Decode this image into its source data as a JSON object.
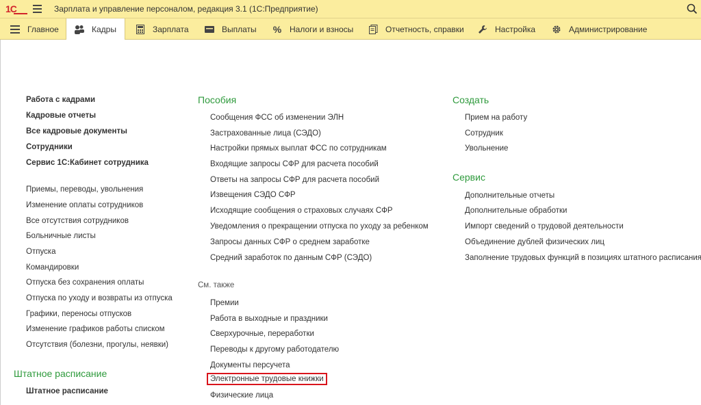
{
  "app": {
    "logo_text": "1С",
    "title": "Зарплата и управление персоналом, редакция 3.1  (1С:Предприятие)"
  },
  "sections": [
    {
      "label": "Главное",
      "icon": "menu-lines-icon"
    },
    {
      "label": "Кадры",
      "icon": "users-icon"
    },
    {
      "label": "Зарплата",
      "icon": "calculator-icon"
    },
    {
      "label": "Выплаты",
      "icon": "wallet-icon"
    },
    {
      "label": "Налоги и взносы",
      "icon": "percent-icon"
    },
    {
      "label": "Отчетность, справки",
      "icon": "documents-icon"
    },
    {
      "label": "Настройка",
      "icon": "wrench-icon"
    },
    {
      "label": "Администрирование",
      "icon": "gear-icon"
    }
  ],
  "left": {
    "bold_items": [
      "Работа с кадрами",
      "Кадровые отчеты",
      "Все кадровые документы",
      "Сотрудники",
      "Сервис 1С:Кабинет сотрудника"
    ],
    "items": [
      "Приемы, переводы, увольнения",
      "Изменение оплаты сотрудников",
      "Все отсутствия сотрудников",
      "Больничные листы",
      "Отпуска",
      "Командировки",
      "Отпуска без сохранения оплаты",
      "Отпуска по уходу и возвраты из отпуска",
      "Графики, переносы отпусков",
      "Изменение графиков работы списком",
      "Отсутствия (болезни, прогулы, неявки)"
    ],
    "group_staff": "Штатное расписание",
    "staff_item": "Штатное расписание"
  },
  "middle": {
    "group_title": "Пособия",
    "items": [
      "Сообщения ФСС об изменении ЭЛН",
      "Застрахованные лица (СЭДО)",
      "Настройки прямых выплат ФСС по сотрудникам",
      "Входящие запросы СФР для расчета пособий",
      "Ответы на запросы СФР для расчета пособий",
      "Извещения СЭДО СФР",
      "Исходящие сообщения о страховых случаях СФР",
      "Уведомления о прекращении отпуска по уходу за ребенком",
      "Запросы данных СФР о среднем заработке",
      "Средний заработок по данным СФР (СЭДО)"
    ],
    "see_also": "См. также",
    "see_also_items": [
      "Премии",
      "Работа в выходные и праздники",
      "Сверхурочные, переработки",
      "Переводы к другому работодателю",
      "Документы персучета",
      "Электронные трудовые книжки",
      "Физические лица"
    ]
  },
  "right": {
    "create_title": "Создать",
    "create_items": [
      "Прием на работу",
      "Сотрудник",
      "Увольнение"
    ],
    "service_title": "Сервис",
    "service_items": [
      "Дополнительные отчеты",
      "Дополнительные обработки",
      "Импорт сведений о трудовой деятельности",
      "Объединение дублей физических лиц",
      "Заполнение трудовых функций в позициях штатного расписания"
    ]
  }
}
